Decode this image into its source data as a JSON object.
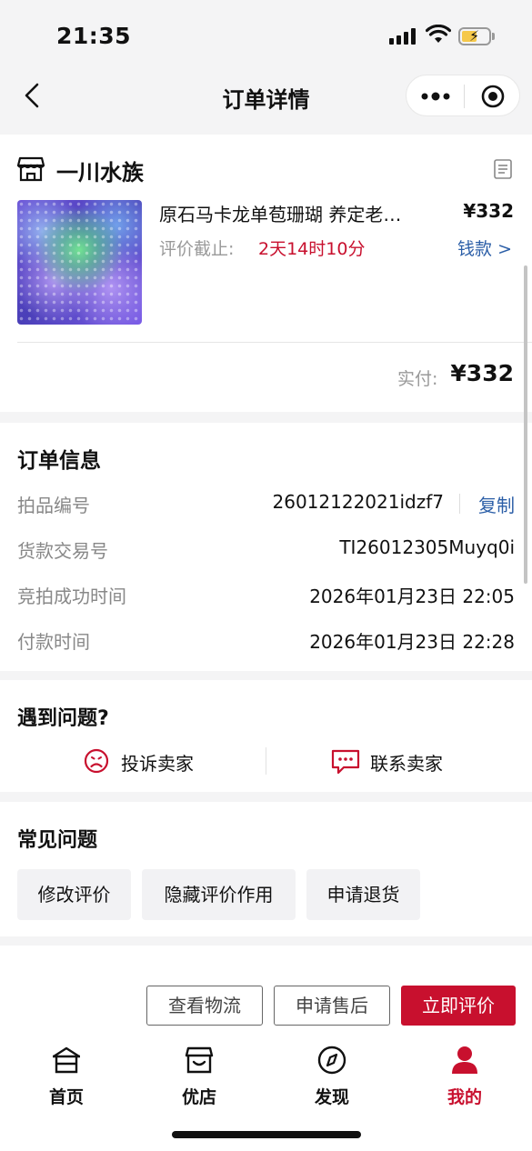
{
  "status_bar": {
    "time": "21:35"
  },
  "nav": {
    "title": "订单详情"
  },
  "shop": {
    "name": "一川水族",
    "product": {
      "title": "原石马卡龙单苞珊瑚 养定老…",
      "price": "¥332",
      "deadline_label": "评价截止:",
      "deadline_value": "2天14时10分",
      "refund_link": "钱款 >"
    },
    "paid_label": "实付:",
    "paid_value": "¥332"
  },
  "order_info": {
    "title": "订单信息",
    "rows": [
      {
        "label": "拍品编号",
        "value": "26012122021idzf7"
      },
      {
        "label": "货款交易号",
        "value": "TI26012305Muyq0i"
      },
      {
        "label": "竞拍成功时间",
        "value": "2026年01月23日 22:05"
      },
      {
        "label": "付款时间",
        "value": "2026年01月23日 22:28"
      }
    ],
    "copy_label": "复制"
  },
  "problem": {
    "title": "遇到问题?",
    "complain": "投诉卖家",
    "contact": "联系卖家"
  },
  "faq": {
    "title": "常见问题",
    "chips": [
      "修改评价",
      "隐藏评价作用",
      "申请退货"
    ]
  },
  "actions": {
    "logistics": "查看物流",
    "after_sale": "申请售后",
    "review": "立即评价"
  },
  "tabs": [
    {
      "label": "首页",
      "icon": "home-icon"
    },
    {
      "label": "优店",
      "icon": "store-icon"
    },
    {
      "label": "发现",
      "icon": "compass-icon"
    },
    {
      "label": "我的",
      "icon": "user-icon",
      "active": true
    }
  ],
  "colors": {
    "accent": "#c8102e",
    "link": "#2b5ea7"
  }
}
